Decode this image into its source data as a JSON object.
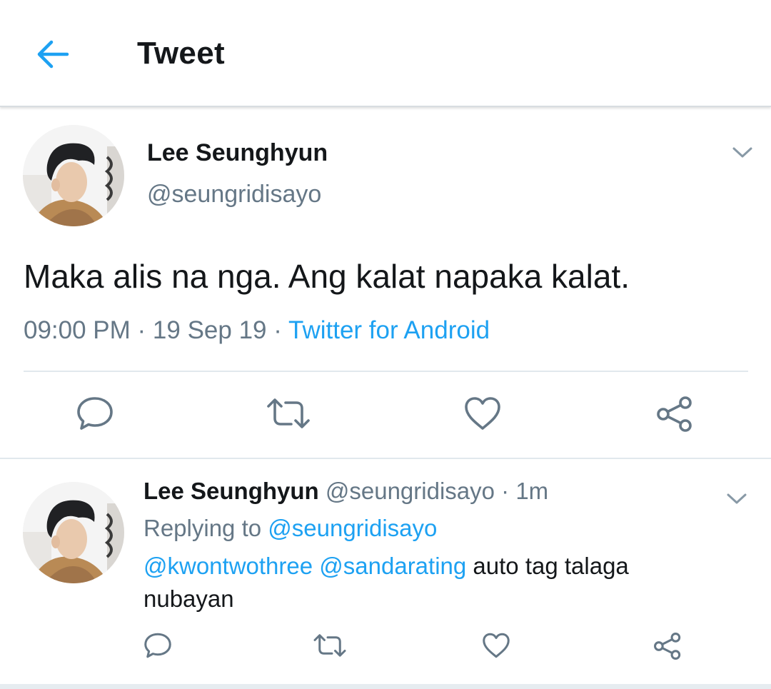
{
  "header": {
    "title": "Tweet",
    "back_icon": "arrow-left-icon"
  },
  "tweet": {
    "author_name": "Lee Seunghyun",
    "handle": "@seungridisayo",
    "text": "Maka alis na nga. Ang kalat napaka kalat.",
    "time": "09:00 PM",
    "date": "19 Sep 19",
    "separator": " · ",
    "source": "Twitter for Android",
    "actions": [
      "reply-icon",
      "retweet-icon",
      "like-icon",
      "share-icon"
    ]
  },
  "reply": {
    "author_name": "Lee Seunghyun",
    "handle": "@seungridisayo",
    "separator": " · ",
    "time": "1m",
    "replying_prefix": "Replying to ",
    "replying_to": "@seungridisayo",
    "mention1": "@kwontwothree",
    "mention2": "@sandarating",
    "text": " auto tag talaga nubayan",
    "actions": [
      "reply-icon",
      "retweet-icon",
      "like-icon",
      "share-icon"
    ]
  },
  "colors": {
    "accent": "#1da1f2",
    "secondary_text": "#657786",
    "primary_text": "#14171a",
    "divider": "#e1e8ed"
  }
}
